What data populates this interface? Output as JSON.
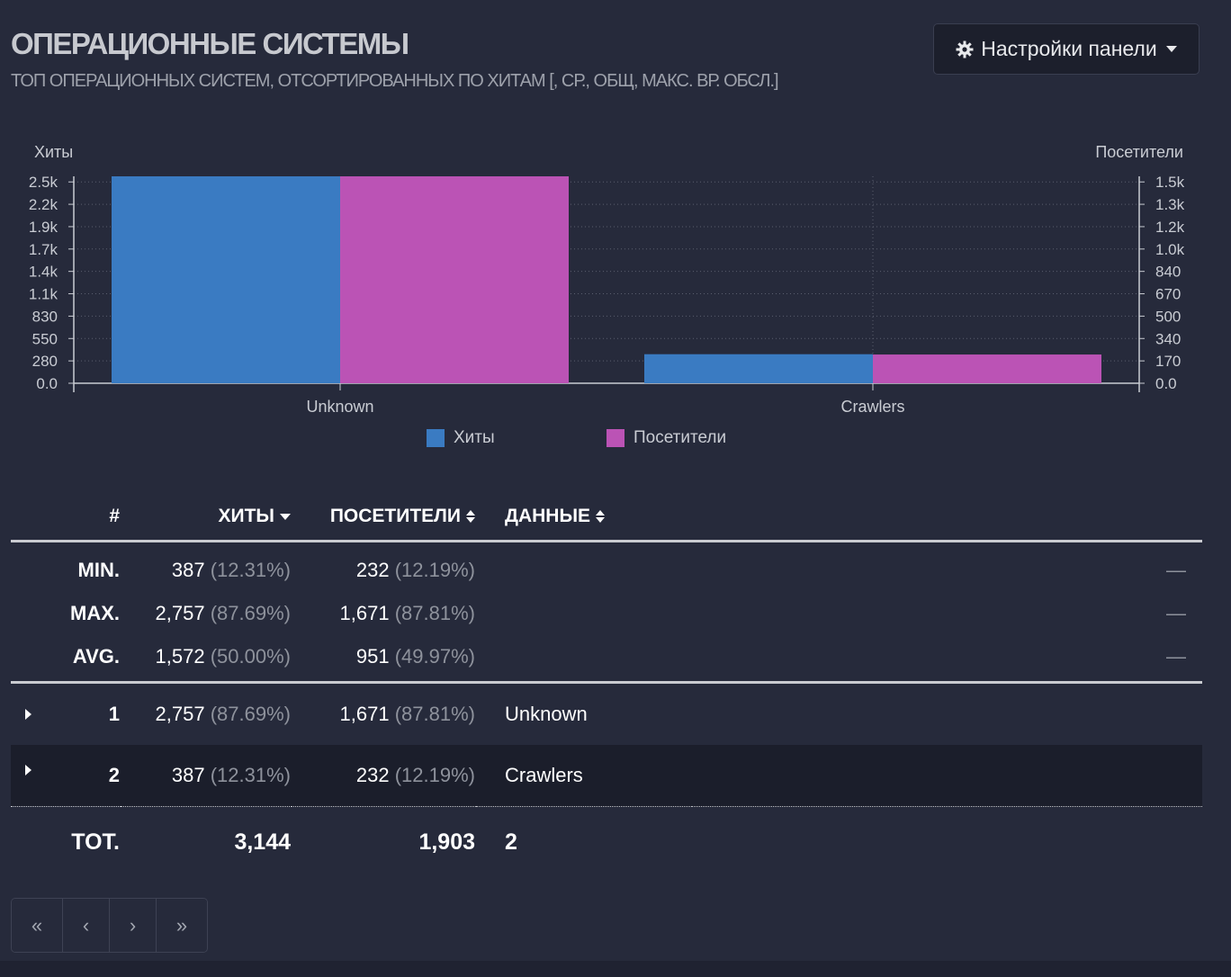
{
  "panel": {
    "title": "ОПЕРАЦИОННЫЕ СИСТЕМЫ",
    "subtitle": "ТОП ОПЕРАЦИОННЫХ СИСТЕМ, ОТСОРТИРОВАННЫХ ПО ХИТАМ [, СР., ОБЩ, МАКС. ВР. ОБСЛ.]",
    "settings_label": "Настройки панели",
    "settings_icon": "gear-icon"
  },
  "chart_data": {
    "type": "bar",
    "categories": [
      "Unknown",
      "Crawlers"
    ],
    "series": [
      {
        "name": "Хиты",
        "values": [
          2757,
          387
        ],
        "color": "#3a7bc2",
        "axis": "left"
      },
      {
        "name": "Посетители",
        "values": [
          1671,
          232
        ],
        "color": "#bb53b5",
        "axis": "right"
      }
    ],
    "ylabel_left": "Хиты",
    "ylabel_right": "Посетители",
    "yticks_left": [
      "0.0",
      "280",
      "550",
      "830",
      "1.1k",
      "1.4k",
      "1.7k",
      "1.9k",
      "2.2k",
      "2.5k"
    ],
    "yticks_right": [
      "0.0",
      "170",
      "340",
      "500",
      "670",
      "840",
      "1.0k",
      "1.2k",
      "1.3k",
      "1.5k"
    ],
    "ylim_left": [
      0,
      2757
    ],
    "ylim_right": [
      0,
      1671
    ],
    "grid": true,
    "legend": "bottom-center"
  },
  "table": {
    "headers": {
      "num": "#",
      "hits": "ХИТЫ",
      "visitors": "ПОСЕТИТЕЛИ",
      "data": "ДАННЫЕ"
    },
    "stats": [
      {
        "label": "MIN.",
        "hits": "387",
        "hits_pct": "(12.31%)",
        "visitors": "232",
        "visitors_pct": "(12.19%)",
        "data": "—"
      },
      {
        "label": "MAX.",
        "hits": "2,757",
        "hits_pct": "(87.69%)",
        "visitors": "1,671",
        "visitors_pct": "(87.81%)",
        "data": "—"
      },
      {
        "label": "AVG.",
        "hits": "1,572",
        "hits_pct": "(50.00%)",
        "visitors": "951",
        "visitors_pct": "(49.97%)",
        "data": "—"
      }
    ],
    "rows": [
      {
        "num": "1",
        "hits": "2,757",
        "hits_pct": "(87.69%)",
        "visitors": "1,671",
        "visitors_pct": "(87.81%)",
        "data": "Unknown"
      },
      {
        "num": "2",
        "hits": "387",
        "hits_pct": "(12.31%)",
        "visitors": "232",
        "visitors_pct": "(12.19%)",
        "data": "Crawlers"
      }
    ],
    "total": {
      "label": "TOT.",
      "hits": "3,144",
      "visitors": "1,903",
      "data": "2"
    }
  },
  "pagination": {
    "first": "«",
    "prev": "‹",
    "next": "›",
    "last": "»"
  }
}
